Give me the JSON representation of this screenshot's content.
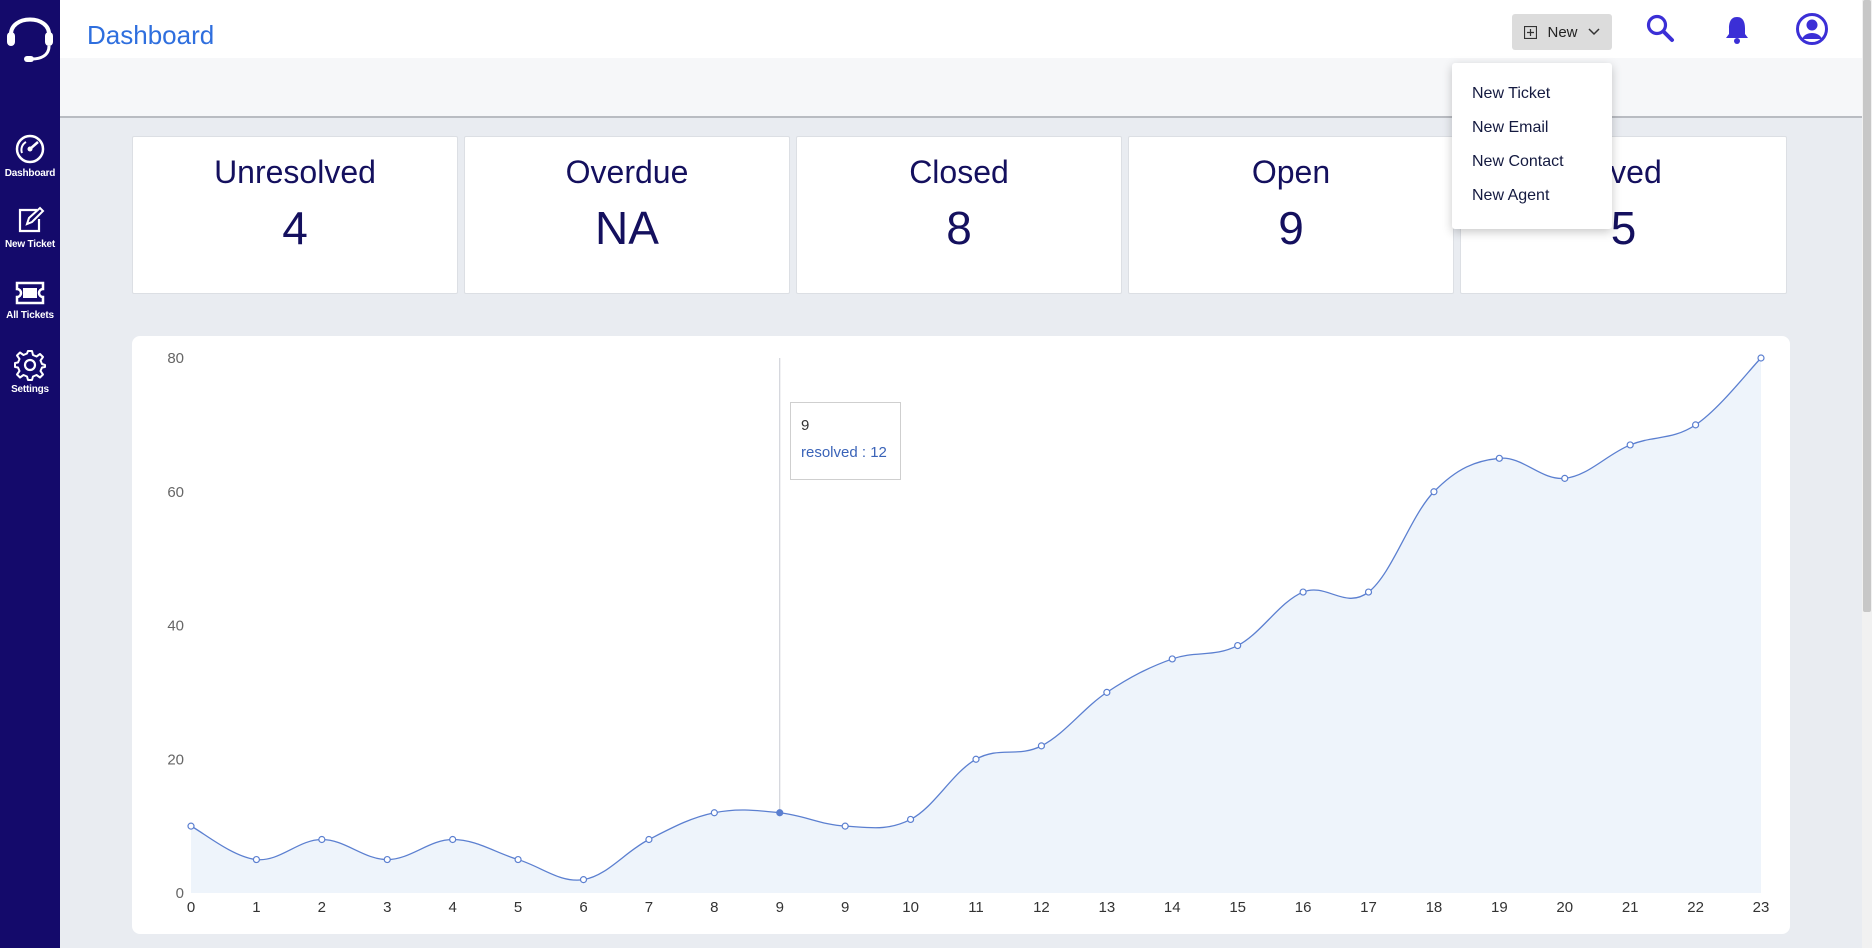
{
  "header": {
    "title": "Dashboard",
    "new_button_label": "New"
  },
  "sidebar": {
    "items": [
      {
        "label": "Dashboard",
        "icon": "dashboard-gauge-icon"
      },
      {
        "label": "New Ticket",
        "icon": "edit-icon"
      },
      {
        "label": "All Tickets",
        "icon": "ticket-icon"
      },
      {
        "label": "Settings",
        "icon": "gear-icon"
      }
    ]
  },
  "dropdown": {
    "items": [
      "New Ticket",
      "New Email",
      "New Contact",
      "New Agent"
    ]
  },
  "stats": [
    {
      "label": "Unresolved",
      "value": "4"
    },
    {
      "label": "Overdue",
      "value": "NA"
    },
    {
      "label": "Closed",
      "value": "8"
    },
    {
      "label": "Open",
      "value": "9"
    },
    {
      "label": "olved",
      "value": "5"
    }
  ],
  "tooltip": {
    "x_label": "9",
    "series_text": "resolved : 12"
  },
  "colors": {
    "sidebar": "#140a6b",
    "title": "#2f6fde",
    "card_text": "#14105e",
    "line": "#5b7fd0",
    "area": "#eef4fb"
  },
  "chart_data": {
    "type": "area",
    "x": [
      "0",
      "1",
      "2",
      "3",
      "4",
      "5",
      "6",
      "7",
      "8",
      "9",
      "9",
      "10",
      "11",
      "12",
      "13",
      "14",
      "15",
      "16",
      "17",
      "18",
      "19",
      "20",
      "21",
      "22",
      "23"
    ],
    "series": [
      {
        "name": "resolved",
        "values": [
          10,
          5,
          8,
          5,
          8,
          5,
          2,
          8,
          12,
          12,
          10,
          11,
          20,
          22,
          30,
          35,
          37,
          45,
          45,
          60,
          65,
          62,
          67,
          70,
          80
        ]
      }
    ],
    "yticks": [
      0,
      20,
      40,
      60,
      80
    ],
    "ylim": [
      0,
      80
    ],
    "active_index": 9
  }
}
